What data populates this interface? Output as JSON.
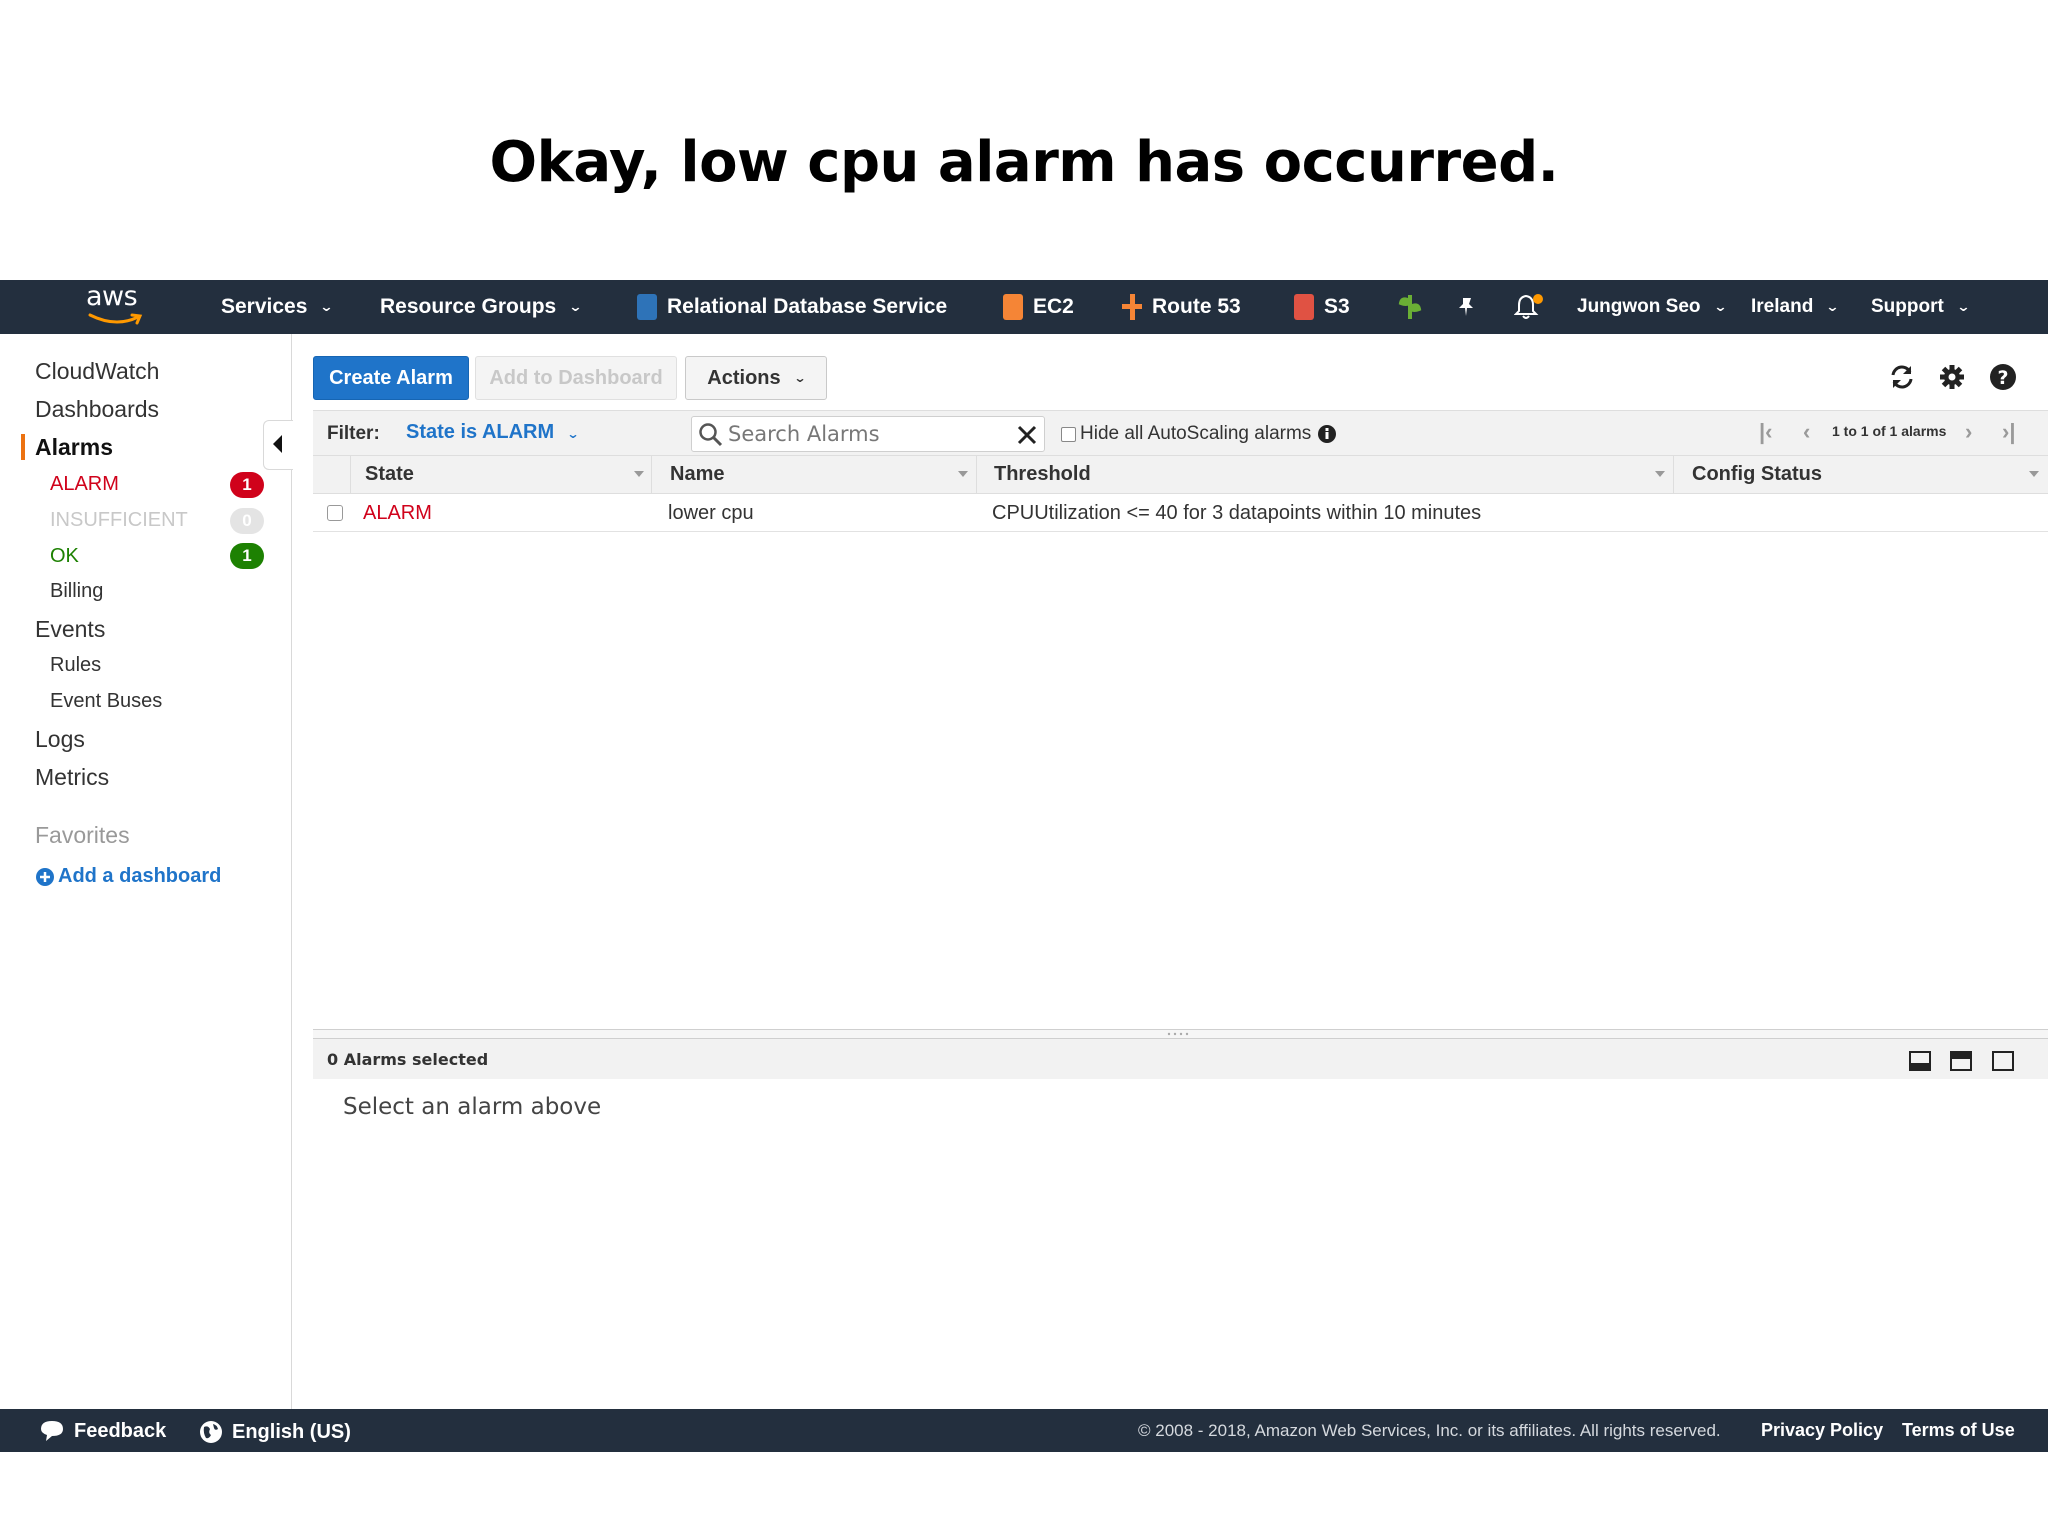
{
  "slide": {
    "title": "Okay, low cpu alarm has occurred."
  },
  "topnav": {
    "logo": "aws",
    "services": "Services",
    "resource_groups": "Resource Groups",
    "shortcuts": [
      {
        "label": "Relational Database Service",
        "icon": "rds-icon",
        "color": "#2e73b8"
      },
      {
        "label": "EC2",
        "icon": "ec2-icon",
        "color": "#f58536"
      },
      {
        "label": "Route 53",
        "icon": "route53-icon",
        "color": "#f58536"
      },
      {
        "label": "S3",
        "icon": "s3-icon",
        "color": "#e05243"
      }
    ],
    "user": "Jungwon Seo",
    "region": "Ireland",
    "support": "Support",
    "notification_dot_color": "#f90"
  },
  "sidebar": {
    "cloudwatch": "CloudWatch",
    "dashboards": "Dashboards",
    "alarms": "Alarms",
    "alarm_states": [
      {
        "label": "ALARM",
        "count": "1",
        "color": "#d0021b"
      },
      {
        "label": "INSUFFICIENT",
        "count": "0",
        "color": "#c8c8c8"
      },
      {
        "label": "OK",
        "count": "1",
        "color": "#1d8102"
      }
    ],
    "billing": "Billing",
    "events": "Events",
    "rules": "Rules",
    "event_buses": "Event Buses",
    "logs": "Logs",
    "metrics": "Metrics",
    "favorites": "Favorites",
    "add_dashboard": "Add a dashboard"
  },
  "toolbar": {
    "create_alarm": "Create Alarm",
    "add_to_dashboard": "Add to Dashboard",
    "actions": "Actions"
  },
  "filter": {
    "label": "Filter:",
    "value": "State is ALARM",
    "search_placeholder": "Search Alarms",
    "hide_autoscaling": "Hide all AutoScaling alarms",
    "pager": "1 to 1 of 1 alarms"
  },
  "table": {
    "columns": [
      "State",
      "Name",
      "Threshold",
      "Config Status"
    ],
    "rows": [
      {
        "state": "ALARM",
        "name": "lower cpu",
        "threshold": "CPUUtilization <= 40 for 3 datapoints within 10 minutes",
        "config_status": ""
      }
    ]
  },
  "details": {
    "selected": "0 Alarms selected",
    "message": "Select an alarm above"
  },
  "footer": {
    "feedback": "Feedback",
    "language": "English (US)",
    "copyright": "© 2008 - 2018, Amazon Web Services, Inc. or its affiliates. All rights reserved.",
    "privacy": "Privacy Policy",
    "terms": "Terms of Use"
  }
}
